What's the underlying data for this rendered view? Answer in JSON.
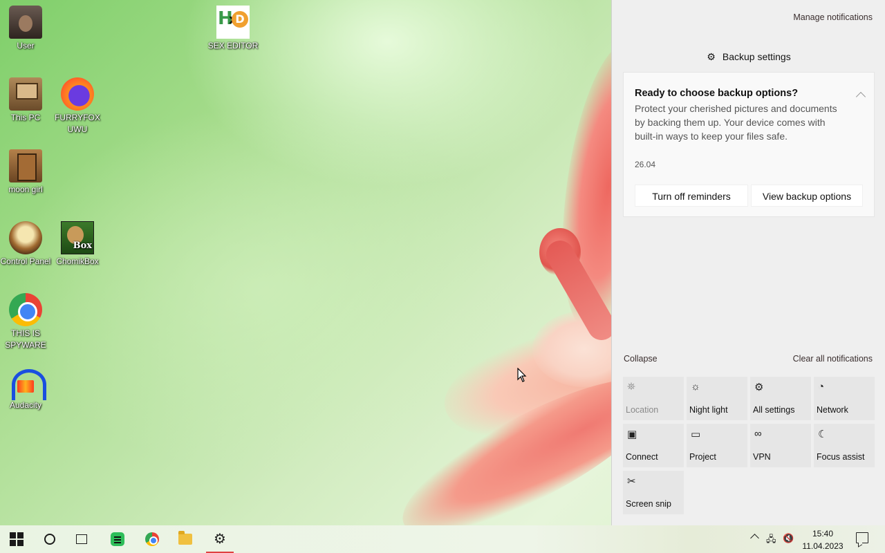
{
  "desktop": {
    "icons": [
      {
        "label": "User",
        "icon": "user-folder-icon"
      },
      {
        "label": "SEX EDITOR",
        "icon": "hex-editor-icon"
      },
      {
        "label": "This PC",
        "icon": "this-pc-icon"
      },
      {
        "label": "FURRYFOX UWU",
        "icon": "firefox-icon"
      },
      {
        "label": "moon girl",
        "icon": "moon-girl-icon"
      },
      {
        "label": "Control Panel",
        "icon": "control-panel-icon"
      },
      {
        "label": "ChomikBox",
        "icon": "chomikbox-icon"
      },
      {
        "label": "THIS IS SPYWARE",
        "icon": "chrome-icon"
      },
      {
        "label": "Audacity",
        "icon": "audacity-icon"
      }
    ],
    "hxd_logo": {
      "h": "H",
      "x": "x",
      "d": "D"
    },
    "chomik_logo_text": "Box"
  },
  "action_center": {
    "manage_label": "Manage notifications",
    "app_name": "Backup settings",
    "notification": {
      "title": "Ready to choose backup options?",
      "body": "Protect your cherished pictures and documents by backing them up. Your device comes with built-in ways to keep your files safe.",
      "date": "26.04",
      "buttons": [
        "Turn off reminders",
        "View backup options"
      ]
    },
    "collapse_label": "Collapse",
    "clear_all_label": "Clear all notifications",
    "quick_actions": [
      {
        "label": "Location",
        "icon": "location-icon",
        "enabled": false,
        "glyph": "⛯"
      },
      {
        "label": "Night light",
        "icon": "night-light-icon",
        "enabled": true,
        "glyph": "☼"
      },
      {
        "label": "All settings",
        "icon": "settings-gear-icon",
        "enabled": true,
        "glyph": "⚙"
      },
      {
        "label": "Network",
        "icon": "network-icon",
        "enabled": true,
        "glyph": "◔"
      },
      {
        "label": "Connect",
        "icon": "connect-icon",
        "enabled": true,
        "glyph": "▣"
      },
      {
        "label": "Project",
        "icon": "project-icon",
        "enabled": true,
        "glyph": "▭"
      },
      {
        "label": "VPN",
        "icon": "vpn-icon",
        "enabled": true,
        "glyph": "∞"
      },
      {
        "label": "Focus assist",
        "icon": "focus-assist-moon-icon",
        "enabled": true,
        "glyph": "☾"
      },
      {
        "label": "Screen snip",
        "icon": "screen-snip-icon",
        "enabled": true,
        "glyph": "✂"
      }
    ]
  },
  "taskbar": {
    "buttons": [
      {
        "name": "start-button",
        "icon": "windows-logo-icon"
      },
      {
        "name": "search-button",
        "icon": "cortana-circle-icon"
      },
      {
        "name": "task-view-button",
        "icon": "task-view-icon"
      },
      {
        "name": "spotify-button",
        "icon": "spotify-icon"
      },
      {
        "name": "chrome-button",
        "icon": "chrome-icon"
      },
      {
        "name": "file-explorer-button",
        "icon": "folder-icon"
      },
      {
        "name": "settings-button",
        "icon": "gear-icon",
        "active": true
      }
    ],
    "tray": {
      "time": "15:40",
      "date": "11.04.2023"
    }
  },
  "colors": {
    "accent_active": "#e04040",
    "panel_bg": "#efefef"
  }
}
